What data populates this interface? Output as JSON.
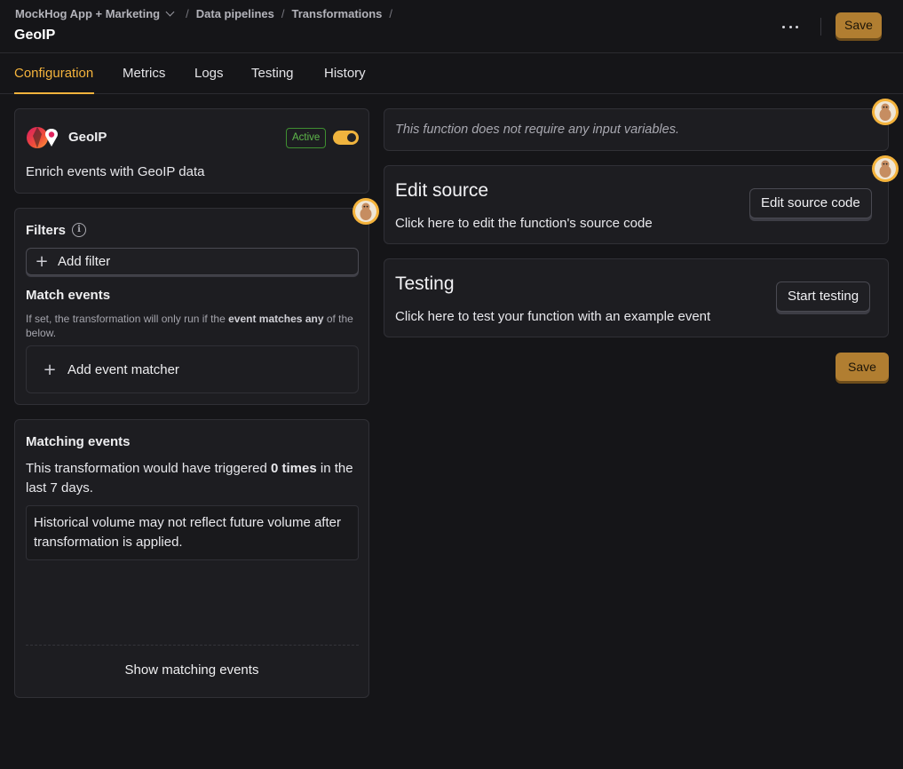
{
  "breadcrumb": {
    "project": "MockHog App + Marketing",
    "items": [
      "Data pipelines",
      "Transformations"
    ]
  },
  "page": {
    "title": "GeoIP"
  },
  "header": {
    "save_label": "Save"
  },
  "tabs": [
    {
      "label": "Configuration",
      "active": true
    },
    {
      "label": "Metrics"
    },
    {
      "label": "Logs"
    },
    {
      "label": "Testing"
    },
    {
      "label": "History"
    }
  ],
  "app": {
    "name": "GeoIP",
    "status": "Active",
    "enabled": true,
    "description": "Enrich events with GeoIP data"
  },
  "filters": {
    "title": "Filters",
    "add_filter_label": "Add filter",
    "match_title": "Match events",
    "help_prefix": "If set, the transformation will only run if the ",
    "help_bold": "event matches any",
    "help_suffix": " of the below.",
    "add_matcher_label": "Add event matcher"
  },
  "matching": {
    "title": "Matching events",
    "text_prefix": "This transformation would have triggered ",
    "text_bold": "0 times",
    "text_suffix": " in the last 7 days.",
    "note": "Historical volume may not reflect future volume after transformation is applied.",
    "show_label": "Show matching events"
  },
  "inputs": {
    "no_vars_text": "This function does not require any input variables."
  },
  "source": {
    "title": "Edit source",
    "subtitle": "Click here to edit the function's source code",
    "button_label": "Edit source code"
  },
  "testing": {
    "title": "Testing",
    "subtitle": "Click here to test your function with an example event",
    "button_label": "Start testing"
  },
  "footer": {
    "save_label": "Save"
  },
  "colors": {
    "accent": "#f4b33c",
    "save_button": "#b17e31",
    "active_badge": "#5fb94b",
    "background": "#151518",
    "card": "#1d1d21"
  },
  "icons": [
    "chevron-down-icon",
    "more-icon",
    "info-icon",
    "plus-icon",
    "geoip-logo",
    "hog-badge-icon"
  ]
}
